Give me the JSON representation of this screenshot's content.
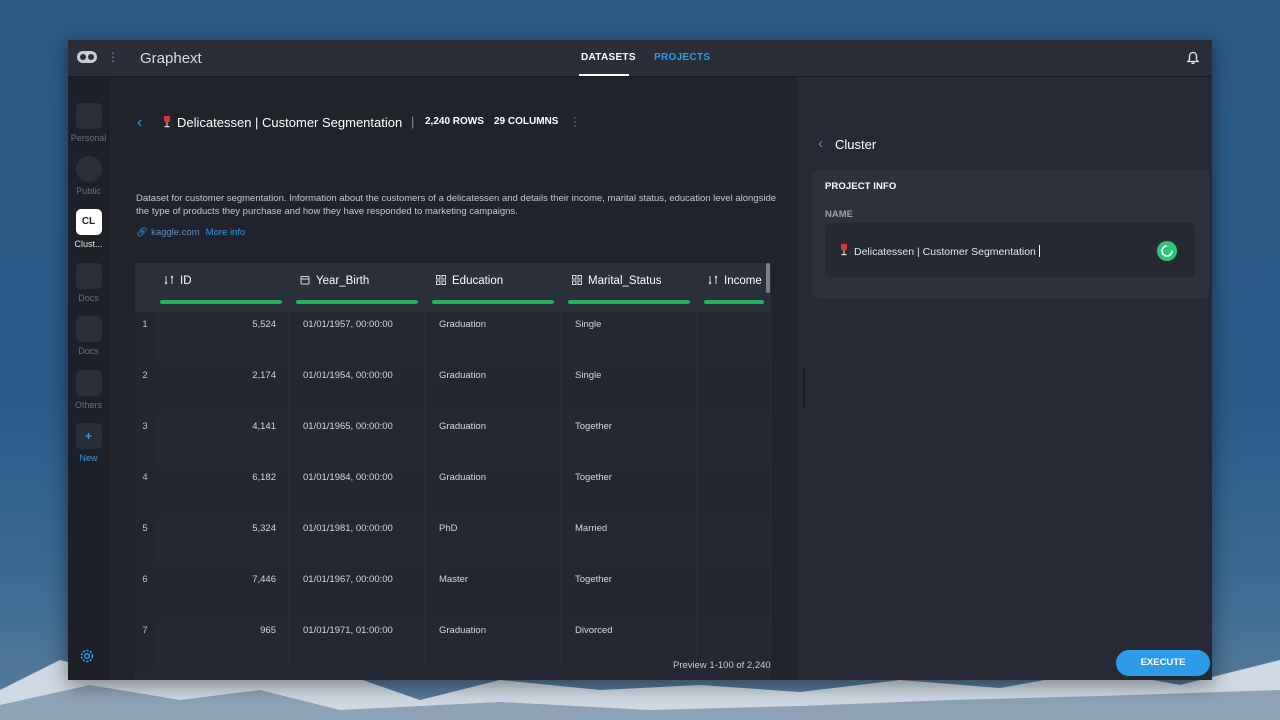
{
  "app": {
    "title": "Graphext"
  },
  "nav": {
    "datasets": "DATASETS",
    "projects": "PROJECTS"
  },
  "sidebar": {
    "items": [
      {
        "label": "Personal"
      },
      {
        "label": "Public"
      },
      {
        "label": "Clust...",
        "icon_text": "CL"
      },
      {
        "label": "Docs"
      },
      {
        "label": "Docs"
      },
      {
        "label": "Others"
      },
      {
        "label": "New",
        "icon_text": "+"
      }
    ],
    "help": "?"
  },
  "dataset": {
    "title": "Delicatessen | Customer Segmentation",
    "separator": "|",
    "rows": "2,240 ROWS",
    "columns": "29 COLUMNS",
    "description": "Dataset for customer segmentation. Information about the customers of a delicatessen and details their income, marital status, education level alongside the type of products they purchase and how they have responded to marketing campaigns.",
    "source": "kaggle.com",
    "more_info": "More info"
  },
  "table": {
    "headers": [
      "ID",
      "Year_Birth",
      "Education",
      "Marital_Status",
      "Income"
    ],
    "rows": [
      {
        "n": "1",
        "id": "5,524",
        "year_birth": "01/01/1957, 00:00:00",
        "education": "Graduation",
        "marital_status": "Single"
      },
      {
        "n": "2",
        "id": "2,174",
        "year_birth": "01/01/1954, 00:00:00",
        "education": "Graduation",
        "marital_status": "Single"
      },
      {
        "n": "3",
        "id": "4,141",
        "year_birth": "01/01/1965, 00:00:00",
        "education": "Graduation",
        "marital_status": "Together"
      },
      {
        "n": "4",
        "id": "6,182",
        "year_birth": "01/01/1984, 00:00:00",
        "education": "Graduation",
        "marital_status": "Together"
      },
      {
        "n": "5",
        "id": "5,324",
        "year_birth": "01/01/1981, 00:00:00",
        "education": "PhD",
        "marital_status": "Married"
      },
      {
        "n": "6",
        "id": "7,446",
        "year_birth": "01/01/1967, 00:00:00",
        "education": "Master",
        "marital_status": "Together"
      },
      {
        "n": "7",
        "id": "965",
        "year_birth": "01/01/1971, 01:00:00",
        "education": "Graduation",
        "marital_status": "Divorced"
      }
    ],
    "preview": "Preview 1-100 of 2,240"
  },
  "panel": {
    "title": "Cluster",
    "section": "PROJECT INFO",
    "name_label": "NAME",
    "name_value": "Delicatessen | Customer Segmentation",
    "execute": "EXECUTE"
  },
  "colors": {
    "accent": "#2e9be8",
    "bar": "#23b35c",
    "spinner": "#2fc47c"
  },
  "icons": [
    "app-logo-icon",
    "kebab-icon",
    "bell-icon",
    "back-chevron-icon",
    "wine-glass-icon",
    "link-icon",
    "numeric-column-icon",
    "date-column-icon",
    "category-column-icon",
    "gear-icon",
    "spinner-icon"
  ]
}
